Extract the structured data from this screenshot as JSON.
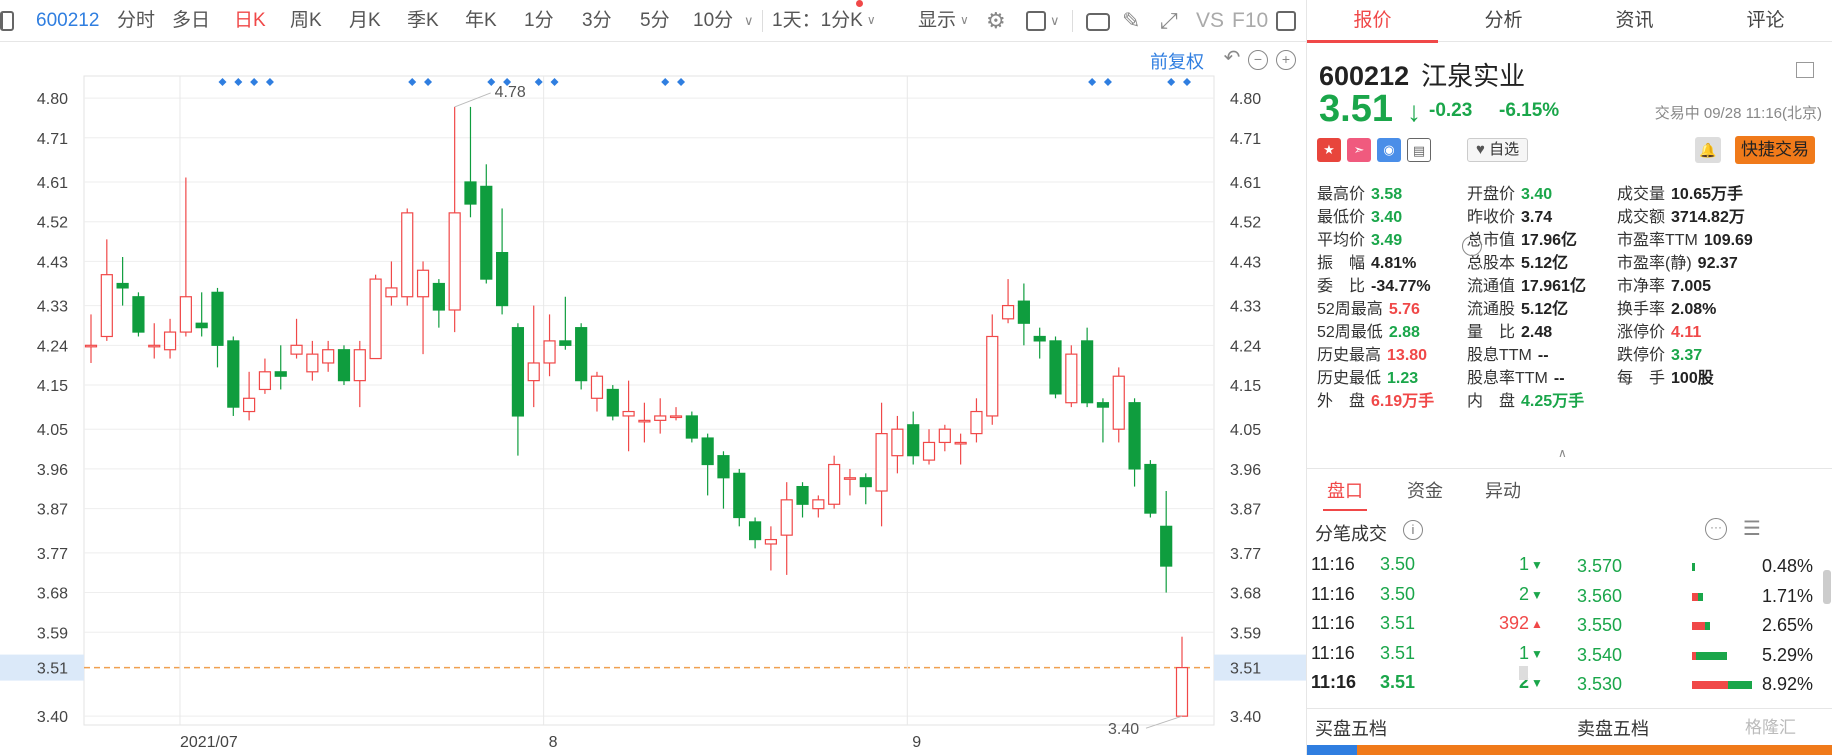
{
  "toolbar": {
    "code": "600212",
    "periods": [
      "分时",
      "多日",
      "日K",
      "周K",
      "月K",
      "季K",
      "年K",
      "1分",
      "3分",
      "5分",
      "10分"
    ],
    "active_period": "日K",
    "period_combo": "1天：1分K",
    "display": "显示",
    "vs": "VS",
    "f10": "F10"
  },
  "chart": {
    "adjust_label": "前复权",
    "price_ticks": [
      "4.80",
      "4.71",
      "4.61",
      "4.52",
      "4.43",
      "4.33",
      "4.24",
      "4.15",
      "4.05",
      "3.96",
      "3.87",
      "3.77",
      "3.68",
      "3.59",
      "3.51",
      "3.40"
    ],
    "x_labels": [
      "2021/07",
      "8",
      "9"
    ],
    "high_label": "4.78",
    "low_label": "3.40",
    "current_price_label": "3.51"
  },
  "chart_data": {
    "type": "candlestick",
    "ylim": [
      3.38,
      4.85
    ],
    "series": [
      {
        "o": 4.24,
        "c": 4.24,
        "h": 4.31,
        "l": 4.2
      },
      {
        "o": 4.26,
        "c": 4.4,
        "h": 4.48,
        "l": 4.25
      },
      {
        "o": 4.38,
        "c": 4.37,
        "h": 4.44,
        "l": 4.33
      },
      {
        "o": 4.35,
        "c": 4.27,
        "h": 4.36,
        "l": 4.26
      },
      {
        "o": 4.24,
        "c": 4.24,
        "h": 4.29,
        "l": 4.21
      },
      {
        "o": 4.23,
        "c": 4.27,
        "h": 4.3,
        "l": 4.21
      },
      {
        "o": 4.27,
        "c": 4.35,
        "h": 4.62,
        "l": 4.26
      },
      {
        "o": 4.29,
        "c": 4.28,
        "h": 4.36,
        "l": 4.26
      },
      {
        "o": 4.36,
        "c": 4.24,
        "h": 4.37,
        "l": 4.19
      },
      {
        "o": 4.25,
        "c": 4.1,
        "h": 4.26,
        "l": 4.08
      },
      {
        "o": 4.09,
        "c": 4.12,
        "h": 4.18,
        "l": 4.07
      },
      {
        "o": 4.14,
        "c": 4.18,
        "h": 4.21,
        "l": 4.13
      },
      {
        "o": 4.18,
        "c": 4.17,
        "h": 4.24,
        "l": 4.14
      },
      {
        "o": 4.22,
        "c": 4.24,
        "h": 4.3,
        "l": 4.21
      },
      {
        "o": 4.18,
        "c": 4.22,
        "h": 4.25,
        "l": 4.16
      },
      {
        "o": 4.2,
        "c": 4.23,
        "h": 4.25,
        "l": 4.18
      },
      {
        "o": 4.23,
        "c": 4.16,
        "h": 4.24,
        "l": 4.15
      },
      {
        "o": 4.16,
        "c": 4.23,
        "h": 4.25,
        "l": 4.1
      },
      {
        "o": 4.21,
        "c": 4.39,
        "h": 4.4,
        "l": 4.21
      },
      {
        "o": 4.35,
        "c": 4.37,
        "h": 4.43,
        "l": 4.33
      },
      {
        "o": 4.35,
        "c": 4.54,
        "h": 4.55,
        "l": 4.33
      },
      {
        "o": 4.35,
        "c": 4.41,
        "h": 4.43,
        "l": 4.22
      },
      {
        "o": 4.38,
        "c": 4.32,
        "h": 4.39,
        "l": 4.28
      },
      {
        "o": 4.32,
        "c": 4.54,
        "h": 4.78,
        "l": 4.27
      },
      {
        "o": 4.61,
        "c": 4.56,
        "h": 4.78,
        "l": 4.53
      },
      {
        "o": 4.6,
        "c": 4.39,
        "h": 4.65,
        "l": 4.38
      },
      {
        "o": 4.45,
        "c": 4.33,
        "h": 4.55,
        "l": 4.31
      },
      {
        "o": 4.28,
        "c": 4.08,
        "h": 4.29,
        "l": 3.99
      },
      {
        "o": 4.16,
        "c": 4.2,
        "h": 4.33,
        "l": 4.1
      },
      {
        "o": 4.2,
        "c": 4.25,
        "h": 4.31,
        "l": 4.17
      },
      {
        "o": 4.25,
        "c": 4.24,
        "h": 4.35,
        "l": 4.23
      },
      {
        "o": 4.28,
        "c": 4.16,
        "h": 4.29,
        "l": 4.14
      },
      {
        "o": 4.12,
        "c": 4.17,
        "h": 4.18,
        "l": 4.09
      },
      {
        "o": 4.14,
        "c": 4.08,
        "h": 4.15,
        "l": 4.07
      },
      {
        "o": 4.08,
        "c": 4.09,
        "h": 4.16,
        "l": 4.0
      },
      {
        "o": 4.07,
        "c": 4.07,
        "h": 4.11,
        "l": 4.02
      },
      {
        "o": 4.07,
        "c": 4.08,
        "h": 4.12,
        "l": 4.04
      },
      {
        "o": 4.08,
        "c": 4.08,
        "h": 4.1,
        "l": 4.07
      },
      {
        "o": 4.08,
        "c": 4.03,
        "h": 4.09,
        "l": 4.02
      },
      {
        "o": 4.03,
        "c": 3.97,
        "h": 4.04,
        "l": 3.9
      },
      {
        "o": 3.99,
        "c": 3.94,
        "h": 4.0,
        "l": 3.87
      },
      {
        "o": 3.95,
        "c": 3.85,
        "h": 3.96,
        "l": 3.83
      },
      {
        "o": 3.84,
        "c": 3.8,
        "h": 3.85,
        "l": 3.78
      },
      {
        "o": 3.79,
        "c": 3.8,
        "h": 3.83,
        "l": 3.73
      },
      {
        "o": 3.81,
        "c": 3.89,
        "h": 3.93,
        "l": 3.72
      },
      {
        "o": 3.92,
        "c": 3.88,
        "h": 3.93,
        "l": 3.85
      },
      {
        "o": 3.87,
        "c": 3.89,
        "h": 3.9,
        "l": 3.85
      },
      {
        "o": 3.88,
        "c": 3.97,
        "h": 3.99,
        "l": 3.87
      },
      {
        "o": 3.94,
        "c": 3.94,
        "h": 3.96,
        "l": 3.9
      },
      {
        "o": 3.94,
        "c": 3.92,
        "h": 3.95,
        "l": 3.88
      },
      {
        "o": 3.91,
        "c": 4.04,
        "h": 4.11,
        "l": 3.83
      },
      {
        "o": 3.99,
        "c": 4.05,
        "h": 4.08,
        "l": 3.95
      },
      {
        "o": 4.06,
        "c": 3.99,
        "h": 4.09,
        "l": 3.97
      },
      {
        "o": 3.98,
        "c": 4.02,
        "h": 4.05,
        "l": 3.97
      },
      {
        "o": 4.02,
        "c": 4.05,
        "h": 4.06,
        "l": 4.0
      },
      {
        "o": 4.02,
        "c": 4.02,
        "h": 4.04,
        "l": 3.97
      },
      {
        "o": 4.04,
        "c": 4.09,
        "h": 4.12,
        "l": 4.02
      },
      {
        "o": 4.08,
        "c": 4.26,
        "h": 4.31,
        "l": 4.06
      },
      {
        "o": 4.3,
        "c": 4.33,
        "h": 4.39,
        "l": 4.29
      },
      {
        "o": 4.34,
        "c": 4.29,
        "h": 4.38,
        "l": 4.24
      },
      {
        "o": 4.26,
        "c": 4.25,
        "h": 4.28,
        "l": 4.21
      },
      {
        "o": 4.25,
        "c": 4.13,
        "h": 4.26,
        "l": 4.12
      },
      {
        "o": 4.11,
        "c": 4.22,
        "h": 4.24,
        "l": 4.1
      },
      {
        "o": 4.25,
        "c": 4.11,
        "h": 4.28,
        "l": 4.1
      },
      {
        "o": 4.11,
        "c": 4.1,
        "h": 4.12,
        "l": 4.02
      },
      {
        "o": 4.05,
        "c": 4.17,
        "h": 4.19,
        "l": 4.02
      },
      {
        "o": 4.11,
        "c": 3.96,
        "h": 4.12,
        "l": 3.92
      },
      {
        "o": 3.97,
        "c": 3.86,
        "h": 3.98,
        "l": 3.85
      },
      {
        "o": 3.83,
        "c": 3.74,
        "h": 3.91,
        "l": 3.68
      },
      {
        "o": 3.4,
        "c": 3.51,
        "h": 3.58,
        "l": 3.4
      }
    ]
  },
  "panel": {
    "tabs": [
      "报价",
      "分析",
      "资讯",
      "评论"
    ],
    "code": "600212",
    "name": "江泉实业",
    "price": "3.51",
    "change": "-0.23",
    "change_pct": "-6.15%",
    "status": "交易中 09/28 11:16(北京)",
    "watch": "自选",
    "fast_trade": "快捷交易",
    "stats": [
      {
        "k": "最高价",
        "v": "3.58",
        "c": "green"
      },
      {
        "k": "开盘价",
        "v": "3.40",
        "c": "green"
      },
      {
        "k": "成交量",
        "v": "10.65万手",
        "c": "dark"
      },
      {
        "k": "最低价",
        "v": "3.40",
        "c": "green"
      },
      {
        "k": "昨收价",
        "v": "3.74",
        "c": "dark"
      },
      {
        "k": "成交额",
        "v": "3714.82万",
        "c": "dark"
      },
      {
        "k": "平均价",
        "v": "3.49",
        "c": "green"
      },
      {
        "k": "总市值",
        "v": "17.96亿",
        "c": "dark"
      },
      {
        "k": "市盈率TTM",
        "v": "109.69",
        "c": "dark"
      },
      {
        "k": "振　幅",
        "v": "4.81%",
        "c": "dark"
      },
      {
        "k": "总股本",
        "v": "5.12亿",
        "c": "dark"
      },
      {
        "k": "市盈率(静)",
        "v": "92.37",
        "c": "dark"
      },
      {
        "k": "委　比",
        "v": "-34.77%",
        "c": "dark"
      },
      {
        "k": "流通值",
        "v": "17.961亿",
        "c": "dark"
      },
      {
        "k": "市净率",
        "v": "7.005",
        "c": "dark"
      },
      {
        "k": "52周最高",
        "v": "5.76",
        "c": "red"
      },
      {
        "k": "流通股",
        "v": "5.12亿",
        "c": "dark"
      },
      {
        "k": "换手率",
        "v": "2.08%",
        "c": "dark"
      },
      {
        "k": "52周最低",
        "v": "2.88",
        "c": "green"
      },
      {
        "k": "量　比",
        "v": "2.48",
        "c": "dark"
      },
      {
        "k": "涨停价",
        "v": "4.11",
        "c": "red"
      },
      {
        "k": "历史最高",
        "v": "13.80",
        "c": "red"
      },
      {
        "k": "股息TTM",
        "v": "--",
        "c": "dark"
      },
      {
        "k": "跌停价",
        "v": "3.37",
        "c": "green"
      },
      {
        "k": "历史最低",
        "v": "1.23",
        "c": "green"
      },
      {
        "k": "股息率TTM",
        "v": "--",
        "c": "dark"
      },
      {
        "k": "每　手",
        "v": "100股",
        "c": "dark"
      },
      {
        "k": "外　盘",
        "v": "6.19万手",
        "c": "red"
      },
      {
        "k": "内　盘",
        "v": "4.25万手",
        "c": "green"
      }
    ],
    "subtabs": [
      "盘口",
      "资金",
      "异动"
    ],
    "trades_title": "分笔成交",
    "trades": [
      {
        "time": "11:16",
        "price": "3.50",
        "vol": "1",
        "dir": "down"
      },
      {
        "time": "11:16",
        "price": "3.50",
        "vol": "2",
        "dir": "down"
      },
      {
        "time": "11:16",
        "price": "3.51",
        "vol": "392",
        "dir": "up"
      },
      {
        "time": "11:16",
        "price": "3.51",
        "vol": "1",
        "dir": "down"
      },
      {
        "time": "11:16",
        "price": "3.51",
        "vol": "2",
        "dir": "down"
      }
    ],
    "distribution": [
      {
        "price": "3.570",
        "pct": "0.48%",
        "frac": 0.05,
        "red": 0.0
      },
      {
        "price": "3.560",
        "pct": "1.71%",
        "frac": 0.19,
        "red": 0.5
      },
      {
        "price": "3.550",
        "pct": "2.65%",
        "frac": 0.3,
        "red": 0.7
      },
      {
        "price": "3.540",
        "pct": "5.29%",
        "frac": 0.59,
        "red": 0.1
      },
      {
        "price": "3.530",
        "pct": "8.92%",
        "frac": 1.0,
        "red": 0.6
      }
    ],
    "buy5": "买盘五档",
    "sell5": "卖盘五档",
    "watermark": "格隆汇"
  }
}
